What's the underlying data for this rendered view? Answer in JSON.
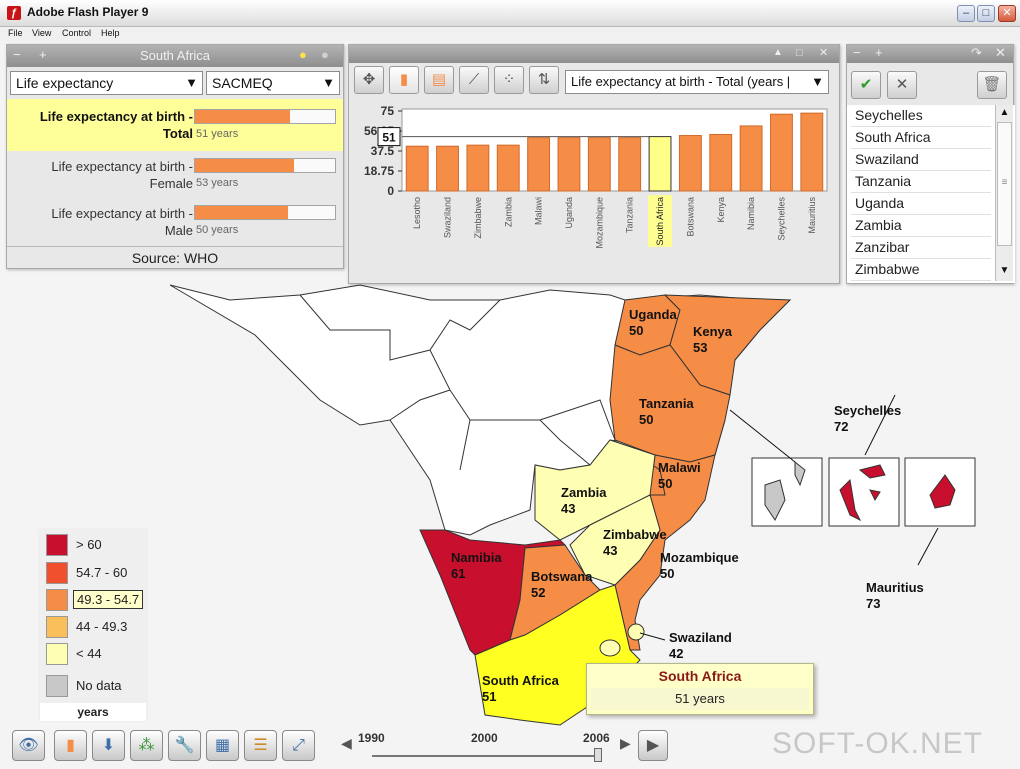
{
  "window": {
    "title": "Adobe Flash Player 9"
  },
  "menu": [
    "File",
    "View",
    "Control",
    "Help"
  ],
  "indicator_panel": {
    "title": "South Africa",
    "indicator_dropdown": "Life expectancy",
    "region_dropdown": "SACMEQ",
    "rows": [
      {
        "label_line1": "Life expectancy at birth -",
        "label_line2": "Total",
        "value_text": "51 years",
        "value": 51
      },
      {
        "label_line1": "Life expectancy at birth -",
        "label_line2": "Female",
        "value_text": "53 years",
        "value": 53
      },
      {
        "label_line1": "Life expectancy at birth -",
        "label_line2": "Male",
        "value_text": "50 years",
        "value": 50
      }
    ],
    "source": "Source: WHO"
  },
  "chart_panel": {
    "dropdown": "Life expectancy at birth - Total (years |",
    "highlight_value_label": "51"
  },
  "chart_data": {
    "type": "bar",
    "categories": [
      "Lesotho",
      "Swaziland",
      "Zimbabwe",
      "Zambia",
      "Malawi",
      "Uganda",
      "Mozambique",
      "Tanzania",
      "South Africa",
      "Botswana",
      "Kenya",
      "Namibia",
      "Seychelles",
      "Mauritius"
    ],
    "values": [
      42,
      42,
      43,
      43,
      50,
      50,
      50,
      50,
      51,
      52,
      53,
      61,
      72,
      73
    ],
    "highlight": "South Africa",
    "yticks": [
      "75",
      "56.25",
      "37.5",
      "18.75",
      "0"
    ],
    "ylim": [
      0,
      75
    ],
    "colors": {
      "bar": "#f58d47",
      "highlight": "#ffff88"
    }
  },
  "country_list": {
    "items": [
      "Seychelles",
      "South Africa",
      "Swaziland",
      "Tanzania",
      "Uganda",
      "Zambia",
      "Zanzibar",
      "Zimbabwe"
    ],
    "accept_icon": "check-icon",
    "reject_icon": "x-icon",
    "delete_icon": "trash-icon"
  },
  "legend": {
    "items": [
      {
        "label": "> 60",
        "color": "#c8102e"
      },
      {
        "label": "54.7 - 60",
        "color": "#f0502e"
      },
      {
        "label": "49.3 - 54.7",
        "color": "#f58d47"
      },
      {
        "label": "44 - 49.3",
        "color": "#f9bf5a"
      },
      {
        "label": "< 44",
        "color": "#ffffb3"
      },
      {
        "label": "No data",
        "color": "#c8c8c8"
      }
    ],
    "unit": "years",
    "selected": "49.3 - 54.7"
  },
  "map_labels": [
    {
      "name": "Uganda",
      "value": "50"
    },
    {
      "name": "Kenya",
      "value": "53"
    },
    {
      "name": "Tanzania",
      "value": "50"
    },
    {
      "name": "Malawi",
      "value": "50"
    },
    {
      "name": "Zambia",
      "value": "43"
    },
    {
      "name": "Zimbabwe",
      "value": "43"
    },
    {
      "name": "Mozambique",
      "value": "50"
    },
    {
      "name": "Namibia",
      "value": "61"
    },
    {
      "name": "Botswana",
      "value": "52"
    },
    {
      "name": "Swaziland",
      "value": "42"
    },
    {
      "name": "South Africa",
      "value": "51"
    },
    {
      "name": "Seychelles",
      "value": "72"
    },
    {
      "name": "Mauritius",
      "value": "73"
    }
  ],
  "tooltip": {
    "title": "South Africa",
    "value": "51 years"
  },
  "timeline": {
    "years": [
      "1990",
      "2000",
      "2006"
    ]
  },
  "watermark": "SOFT-OK.NET"
}
